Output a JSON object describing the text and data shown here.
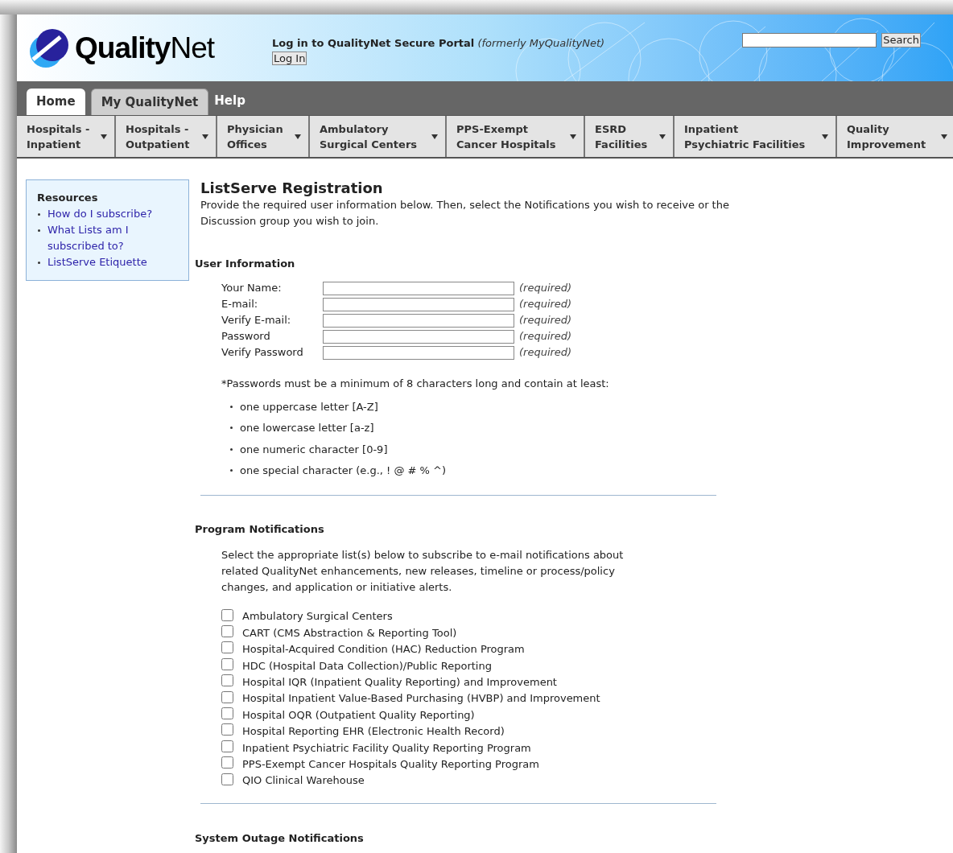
{
  "header": {
    "logo": "**Quality**Net",
    "login_text": "Log in to QualityNet Secure Portal",
    "login_note": "(formerly MyQualityNet)",
    "login_button": "Log In",
    "search_button": "Search"
  },
  "tabs": [
    {
      "kind": "tab",
      "label": "Home",
      "selected": true
    },
    {
      "kind": "tab",
      "label": "My QualityNet",
      "selected": false
    },
    {
      "kind": "link",
      "label": "Help",
      "selected": false
    }
  ],
  "nav": [
    {
      "lines": [
        "Hospitals -",
        "Inpatient"
      ]
    },
    {
      "lines": [
        "Hospitals -",
        "Outpatient"
      ]
    },
    {
      "lines": [
        "Physician",
        "Offices"
      ]
    },
    {
      "lines": [
        "Ambulatory",
        "Surgical Centers"
      ]
    },
    {
      "lines": [
        "PPS-Exempt",
        "Cancer Hospitals"
      ]
    },
    {
      "lines": [
        "ESRD",
        "Facilities"
      ]
    },
    {
      "lines": [
        "Inpatient",
        "Psychiatric Facilities"
      ]
    },
    {
      "lines": [
        "Quality",
        "Improvement"
      ]
    }
  ],
  "sidebar": {
    "title": "Resources",
    "links": [
      "How do I subscribe?",
      "What Lists am I subscribed to?",
      "ListServe Etiquette"
    ]
  },
  "title": "ListServe Registration",
  "intro": "Provide the required user information below. Then, select the Notifications you wish to receive or the Discussion group you wish to join.",
  "user_info": {
    "heading": "User Information",
    "fields": [
      {
        "label": "Your Name:",
        "note": "(required)"
      },
      {
        "label": "E-mail:",
        "note": "(required)"
      },
      {
        "label": "Verify E-mail:",
        "note": "(required)"
      },
      {
        "label": "Password",
        "note": "(required)"
      },
      {
        "label": "Verify Password",
        "note": "(required)"
      }
    ],
    "password_rule": "*Passwords must be a minimum of 8 characters long and contain at least:",
    "rules": [
      "one uppercase letter [A-Z]",
      "one lowercase letter [a-z]",
      "one numeric character [0-9]",
      "one special character (e.g., ! @ # % ^)"
    ]
  },
  "program_notifications": {
    "heading": "Program Notifications",
    "text": "Select the appropriate list(s) below to subscribe to e-mail notifications about related QualityNet enhancements, new releases, timeline or process/policy changes, and application or initiative alerts.",
    "lists": [
      {
        "label": "Ambulatory Surgical Centers",
        "checked": false
      },
      {
        "label": "CART (CMS Abstraction & Reporting Tool)",
        "checked": false
      },
      {
        "label": "Hospital-Acquired Condition (HAC) Reduction Program",
        "checked": false
      },
      {
        "label": "HDC (Hospital Data Collection)/Public Reporting",
        "checked": false
      },
      {
        "label": "Hospital IQR (Inpatient Quality Reporting) and Improvement",
        "checked": false
      },
      {
        "label": "Hospital Inpatient Value-Based Purchasing (HVBP) and Improvement",
        "checked": false
      },
      {
        "label": "Hospital OQR (Outpatient Quality Reporting)",
        "checked": false
      },
      {
        "label": "Hospital Reporting EHR (Electronic Health Record)",
        "checked": false
      },
      {
        "label": "Inpatient Psychiatric Facility Quality Reporting Program",
        "checked": false
      },
      {
        "label": "PPS-Exempt Cancer Hospitals Quality Reporting Program",
        "checked": false
      },
      {
        "label": "QIO Clinical Warehouse",
        "checked": false
      }
    ]
  },
  "system_outage": {
    "heading": "System Outage Notifications"
  }
}
